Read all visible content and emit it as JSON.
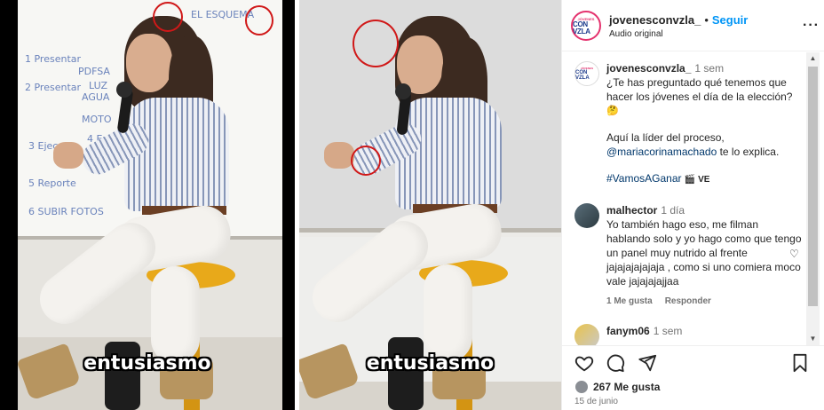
{
  "video_left": {
    "caption": "entusiasmo",
    "whiteboard_text": [
      "EL ESQUEMA",
      "1 Presentar",
      "2 Presentar",
      "PDFSA",
      "LUZ",
      "AGUA",
      "MOTO",
      "3 Ejecutar",
      "4 Explicar",
      "5 Reporte",
      "6 SUBIR FOTOS"
    ]
  },
  "video_mid": {
    "caption": "entusiasmo"
  },
  "post": {
    "account": "jovenesconvzla_",
    "separator": "•",
    "follow_label": "Seguir",
    "audio_label": "Audio original",
    "avatar_top": "JÓVENES",
    "avatar_main": "CON VZLA",
    "more_icon": "more-icon"
  },
  "caption_comment": {
    "user": "jovenesconvzla_",
    "time": "1 sem",
    "line1": "¿Te has preguntado qué tenemos que hacer los jóvenes el día de la elección?",
    "emoji": "🤔",
    "line2_prefix": "Aquí la líder del proceso,",
    "mention": "@mariacorinamachado",
    "line2_suffix": "te lo explica.",
    "hashtag": "#VamosAGanar",
    "flag_text": "🎬 VE"
  },
  "comments": [
    {
      "user": "malhector",
      "time": "1 día",
      "text": "Yo también hago eso, me filman hablando solo y yo hago como que tengo un panel muy nutrido al frente jajajajajajaja , como si uno comiera moco vale jajajajajjaa",
      "likes": "1 Me gusta",
      "reply": "Responder"
    },
    {
      "user": "fanym06",
      "time": "1 sem",
      "text": "",
      "likes": "",
      "reply": ""
    }
  ],
  "actions": {
    "likes": "267 Me gusta",
    "date": "15 de junio"
  },
  "colors": {
    "follow": "#0095f6",
    "annotation": "#d01818",
    "link": "#00376b"
  }
}
